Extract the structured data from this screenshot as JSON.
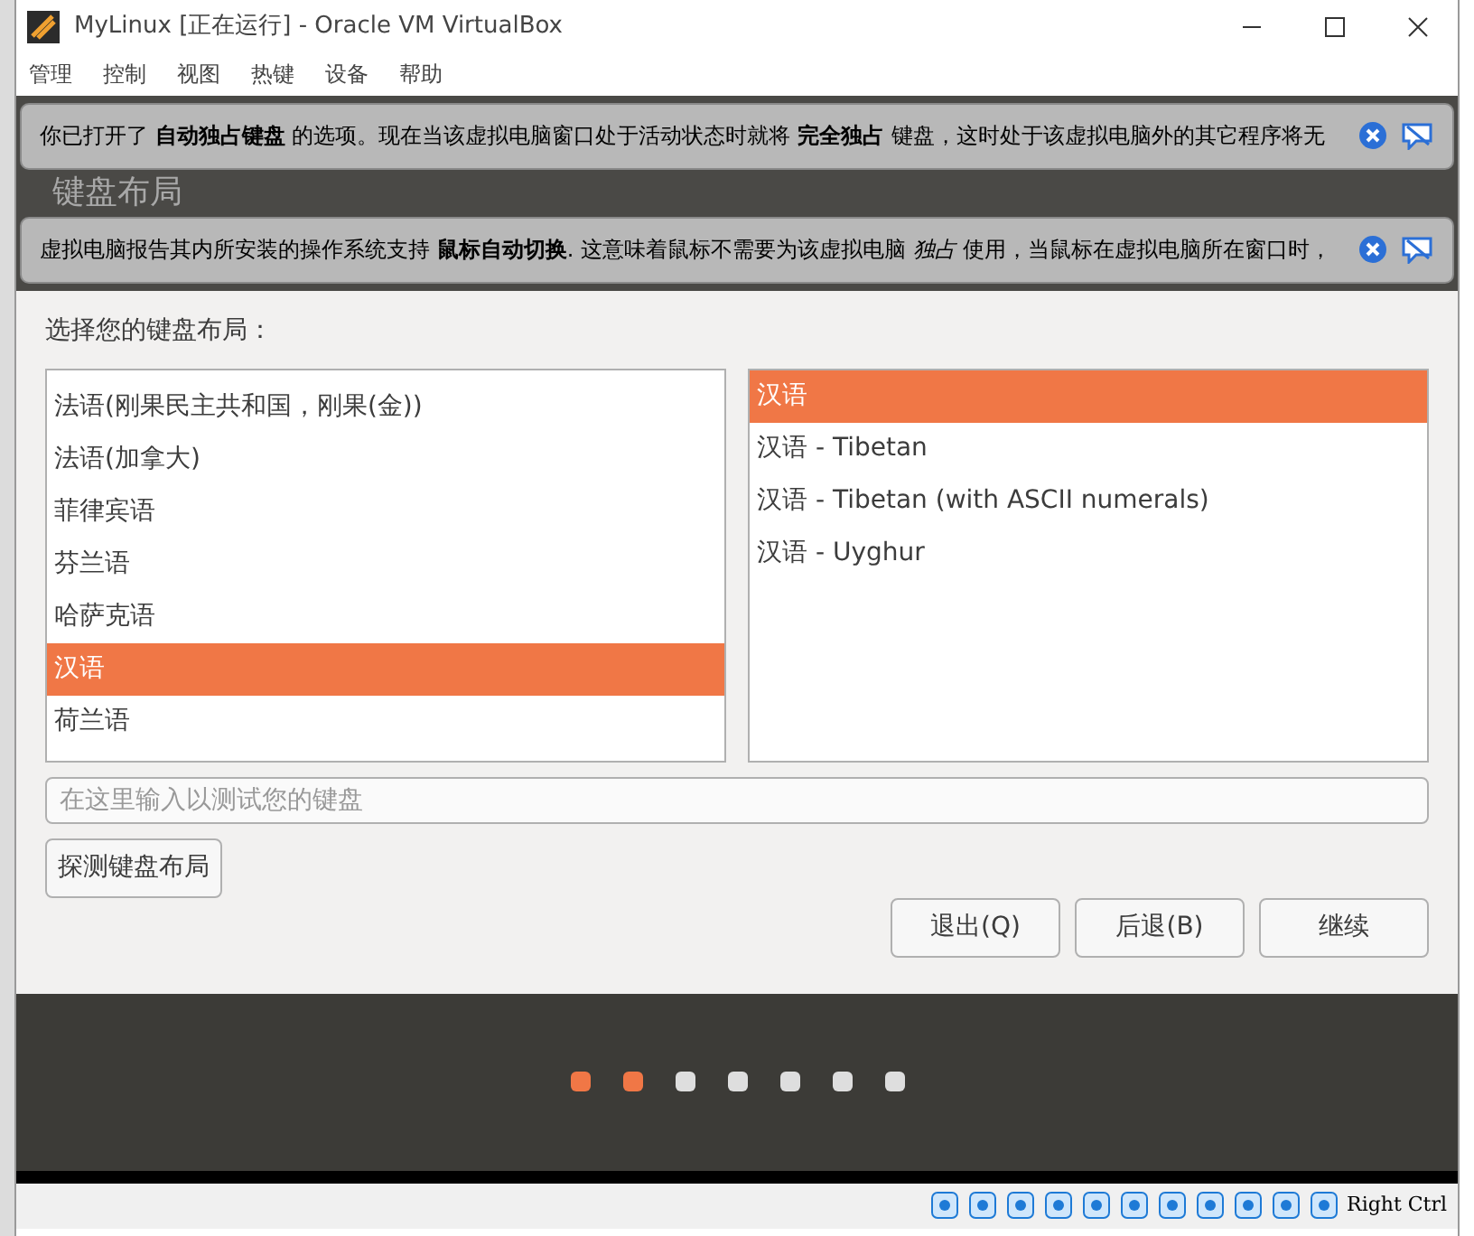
{
  "window": {
    "title": "MyLinux [正在运行] - Oracle VM VirtualBox"
  },
  "menu": [
    "管理",
    "控制",
    "视图",
    "热键",
    "设备",
    "帮助"
  ],
  "notifications": [
    {
      "text": "你已打开了 **自动独占键盘** 的选项。现在当该虚拟电脑窗口处于活动状态时就将 **完全独占** 键盘，这时处于该虚拟电脑外的其它程序将无"
    },
    {
      "text": "虚拟电脑报告其内所安装的操作系统支持 **鼠标自动切换**. 这意味着鼠标不需要为该虚拟电脑 *独占* 使用，当鼠标在虚拟电脑所在窗口时，"
    }
  ],
  "installer": {
    "heading": "键盘布局",
    "prompt": "选择您的键盘布局：",
    "layouts": [
      {
        "label": "法语(刚果民主共和国，刚果(金))",
        "selected": false
      },
      {
        "label": "法语(加拿大)",
        "selected": false
      },
      {
        "label": "菲律宾语",
        "selected": false
      },
      {
        "label": "芬兰语",
        "selected": false
      },
      {
        "label": "哈萨克语",
        "selected": false
      },
      {
        "label": "汉语",
        "selected": true
      },
      {
        "label": "荷兰语",
        "selected": false
      }
    ],
    "variants": [
      {
        "label": "汉语",
        "selected": true
      },
      {
        "label": "汉语 - Tibetan",
        "selected": false
      },
      {
        "label": "汉语 - Tibetan (with ASCII numerals)",
        "selected": false
      },
      {
        "label": "汉语 - Uyghur",
        "selected": false
      }
    ],
    "test_field": {
      "placeholder": "在这里输入以测试您的键盘"
    },
    "detect_button": "探测键盘布局",
    "buttons": [
      "退出(Q)",
      "后退(B)",
      "继续"
    ],
    "steps": [
      {
        "active": true
      },
      {
        "active": true
      },
      {
        "active": false
      },
      {
        "active": false
      },
      {
        "active": false
      },
      {
        "active": false
      },
      {
        "active": false
      }
    ]
  },
  "status_bar": {
    "host_key": "Right Ctrl"
  }
}
